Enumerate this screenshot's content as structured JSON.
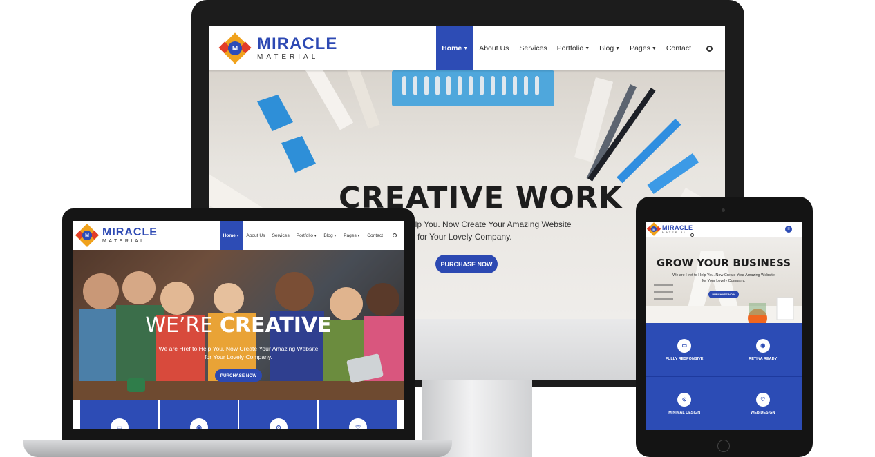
{
  "brand": {
    "line1": "MIRACLE",
    "line2": "MATERIAL",
    "mark": "M"
  },
  "nav": {
    "home": "Home",
    "about": "About Us",
    "services": "Services",
    "portfolio": "Portfolio",
    "blog": "Blog",
    "pages": "Pages",
    "contact": "Contact"
  },
  "icons": {
    "search": "search-icon",
    "chevron": "chevron-down-icon",
    "menu": "menu-icon"
  },
  "monitor_hero": {
    "title": "CREATIVE WORK",
    "line1": "elp You. Now Create Your Amazing Website",
    "line2": "for Your Lovely Company.",
    "button": "PURCHASE NOW"
  },
  "laptop_hero": {
    "title_light": "WE’RE",
    "title_bold": "CREATIVE",
    "line1": "We are Href to Help You. Now Create Your Amazing Website",
    "line2": "for Your Lovely Company.",
    "button": "PURCHASE NOW"
  },
  "tablet_hero": {
    "title": "GROW YOUR BUSINESS",
    "line1": "We are Href to Help You. Now Create Your Amazing Website",
    "line2": "for Your Lovely Company.",
    "button": "PURCHASE NOW"
  },
  "features": [
    {
      "label": "FULLY RESPONSIVE",
      "icon": "devices-icon"
    },
    {
      "label": "RETINA READY",
      "icon": "eye-icon"
    },
    {
      "label": "MINIMAL DESIGN",
      "icon": "target-icon"
    },
    {
      "label": "WEB DESIGN",
      "icon": "heart-icon"
    }
  ],
  "colors": {
    "primary": "#2d4cb5",
    "accent_orange": "#f0a21c",
    "accent_red": "#e23d28"
  }
}
